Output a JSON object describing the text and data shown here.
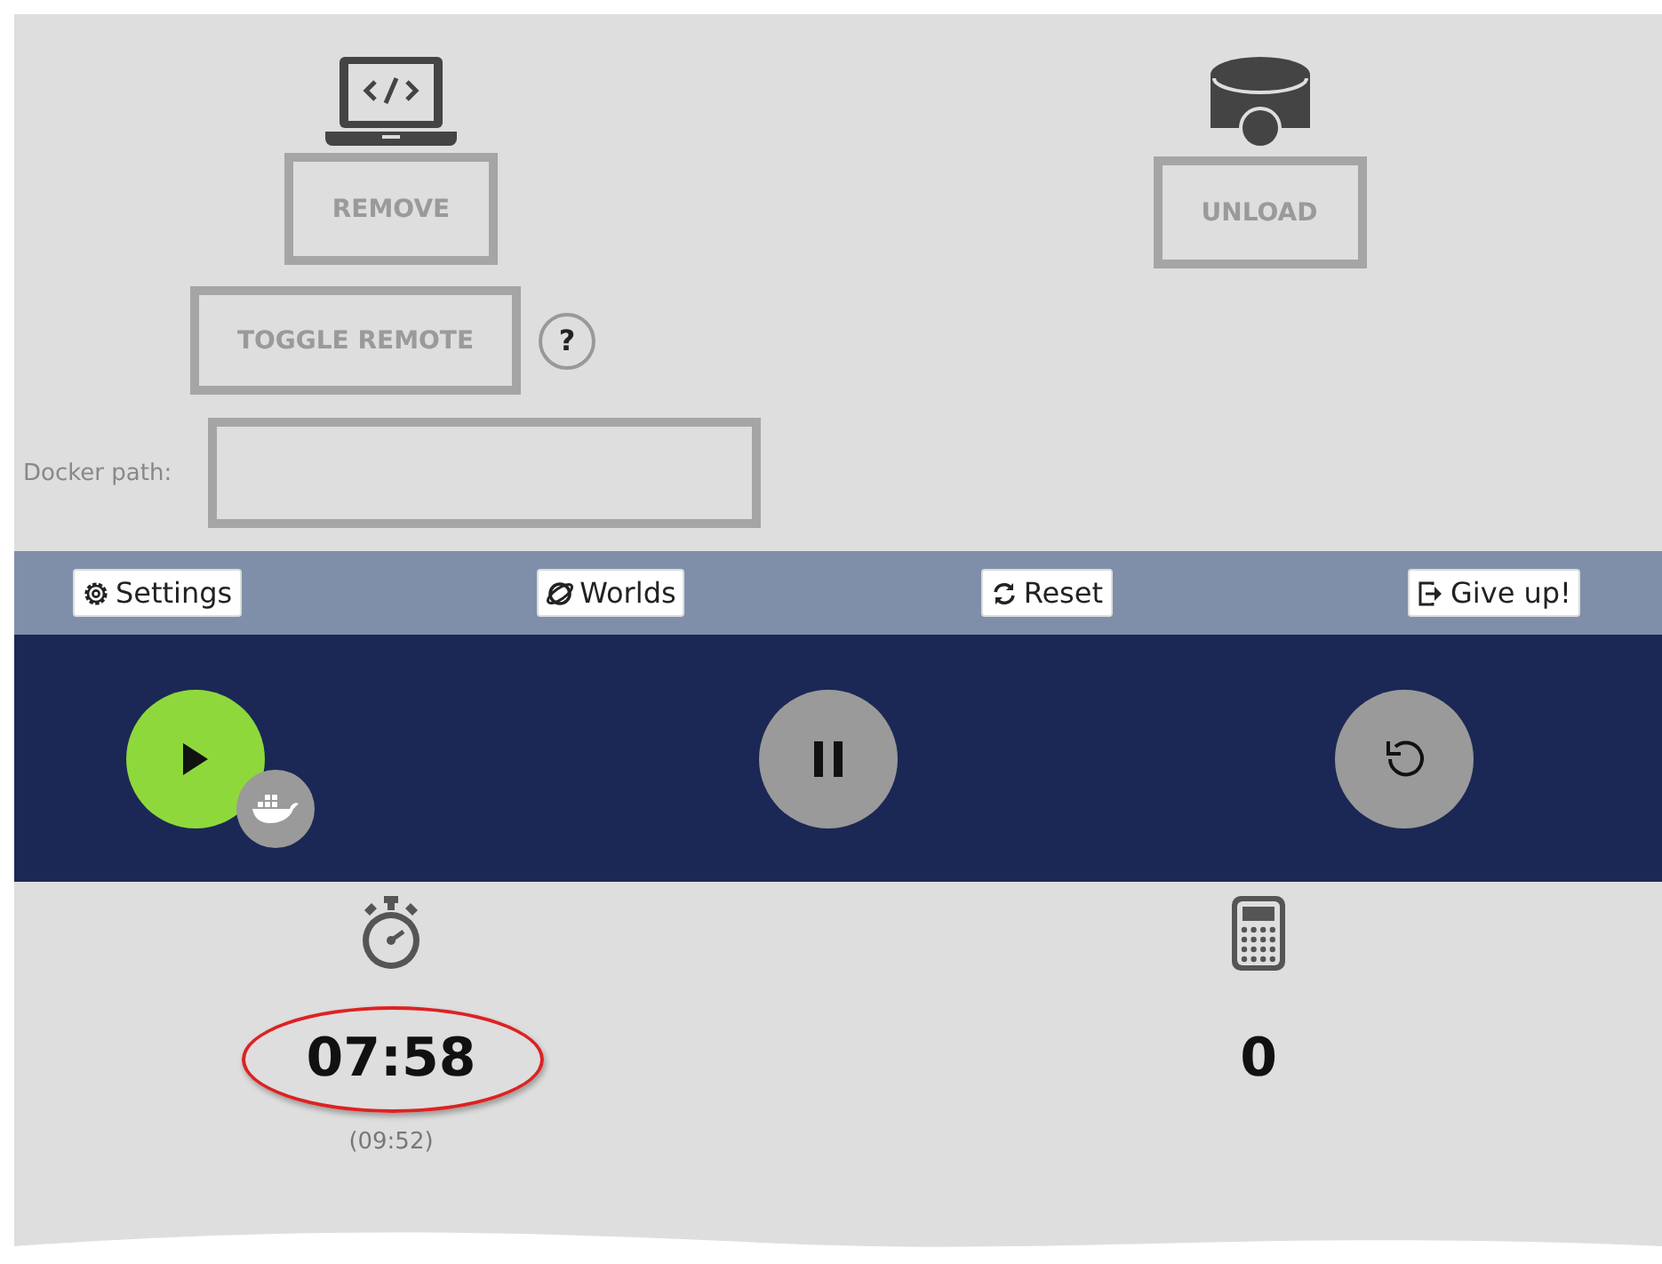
{
  "remote_panel": {
    "remove_button": "REMOVE",
    "toggle_button": "TOGGLE REMOTE",
    "help_button": "?",
    "docker_path": {
      "label": "Docker path:"
    }
  },
  "robot_panel": {
    "unload_button": "UNLOAD"
  },
  "nav": [
    {
      "kind": "settings",
      "label": "Settings"
    },
    {
      "kind": "worlds",
      "label": "Worlds"
    },
    {
      "kind": "reset",
      "label": "Reset"
    },
    {
      "kind": "giveup",
      "label": "Give up!"
    }
  ],
  "controls": [
    {
      "kind": "play",
      "active": true,
      "docker": true
    },
    {
      "kind": "pause",
      "active": false,
      "docker": false
    },
    {
      "kind": "restart",
      "active": false,
      "docker": false
    }
  ],
  "stats": [
    {
      "kind": "time",
      "value": "07:58",
      "highlighted": true,
      "sub": "(09:52)"
    },
    {
      "kind": "count",
      "value": "0",
      "highlighted": false
    }
  ]
}
